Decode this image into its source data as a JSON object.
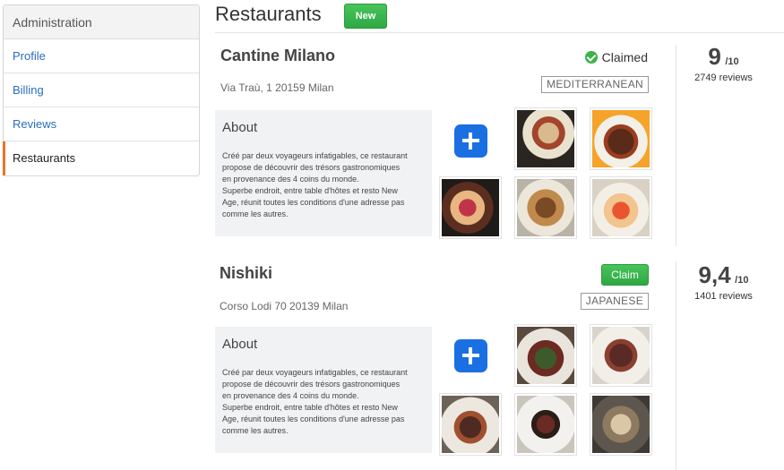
{
  "sidebar": {
    "heading": "Administration",
    "items": [
      {
        "label": "Profile"
      },
      {
        "label": "Billing"
      },
      {
        "label": "Reviews"
      },
      {
        "label": "Restaurants"
      }
    ]
  },
  "header": {
    "title": "Restaurants",
    "new_label": "New"
  },
  "restaurants": [
    {
      "name": "Cantine Milano",
      "status_label": "Claimed",
      "address": "Via Traù, 1 20159 Milan",
      "cuisine": "MEDITERRANEAN",
      "about_title": "About",
      "about_text": "Créé par deux voyageurs infatigables, ce restaurant\npropose de découvrir des trésors gastronomiques\nen provenance des 4 coins du monde.\nSuperbe endroit, entre table d'hôtes et resto New\nAge, réunit toutes les conditions d'une adresse pas\ncomme les autres.",
      "score": "9",
      "outof": "/10",
      "reviews": "2749 reviews"
    },
    {
      "name": "Nishiki",
      "claim_label": "Claim",
      "address": "Corso Lodi 70 20139 Milan",
      "cuisine": "JAPANESE",
      "about_title": "About",
      "about_text": "Créé par deux voyageurs infatigables, ce restaurant\npropose de découvrir des trésors gastronomiques\nen provenance des 4 coins du monde.\nSuperbe endroit, entre table d'hôtes et resto New\nAge, réunit toutes les conditions d'une adresse pas\ncomme les autres.",
      "score": "9,4",
      "outof": "/10",
      "reviews": "1401 reviews"
    }
  ],
  "colors": {
    "accent_green": "#2fa844",
    "link_blue": "#2a6ebb",
    "active_marker": "#e8742a",
    "add_button_blue": "#1a6fe3",
    "claimed_check": "#3bb34a"
  }
}
